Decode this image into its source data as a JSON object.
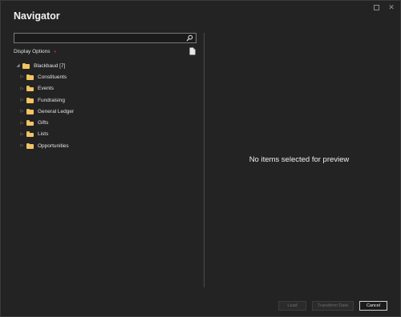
{
  "window": {
    "title": "Navigator",
    "controls": [
      "restore-icon",
      "close-icon"
    ]
  },
  "search": {
    "value": "",
    "placeholder": "",
    "icon": "search-icon"
  },
  "display_options": {
    "label": "Display Options",
    "caret": "▾"
  },
  "tree": {
    "root": {
      "label": "Blackbaud [7]",
      "expander": "◢"
    },
    "items": [
      {
        "label": "Constituents"
      },
      {
        "label": "Events"
      },
      {
        "label": "Fundraising"
      },
      {
        "label": "General Ledger"
      },
      {
        "label": "Gifts"
      },
      {
        "label": "Lists"
      },
      {
        "label": "Opportunities"
      }
    ],
    "child_expander": "▷"
  },
  "preview": {
    "message": "No items selected for preview"
  },
  "footer": {
    "load_label": "Load",
    "transform_label": "Transform Data",
    "cancel_label": "Cancel"
  },
  "colors": {
    "background": "#232323",
    "folder": "#f2c462",
    "accent_caret": "#c0392b"
  }
}
